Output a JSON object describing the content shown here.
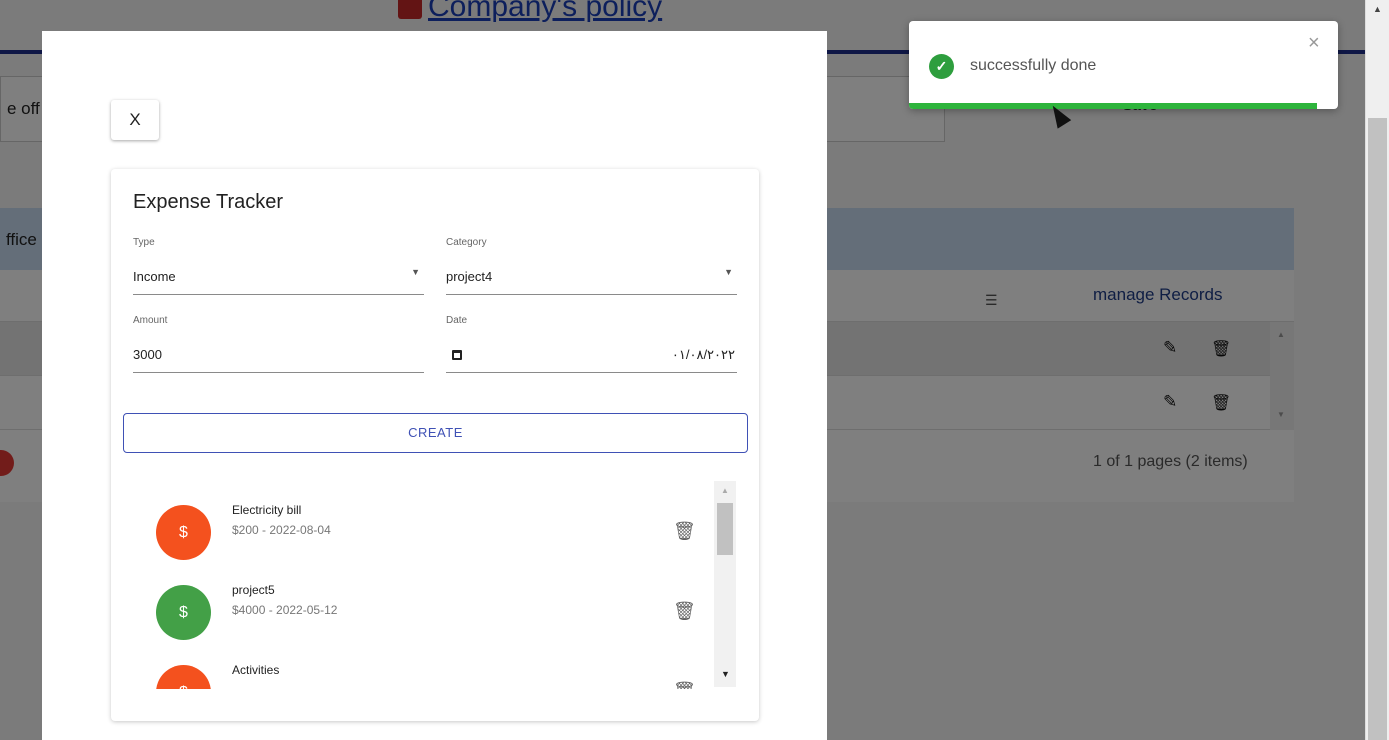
{
  "background": {
    "page_title": "Company's policy",
    "field_text": "e off",
    "button_text": "Save",
    "header_text": "ffice",
    "manage_records": "manage Records",
    "filter_icon": "filter-icon",
    "pagination": "1 of 1 pages (2 items)"
  },
  "modal": {
    "close_label": "X",
    "card_title": "Expense Tracker",
    "type": {
      "label": "Type",
      "value": "Income"
    },
    "category": {
      "label": "Category",
      "value": "project4"
    },
    "amount": {
      "label": "Amount",
      "value": "3000"
    },
    "date": {
      "label": "Date",
      "value": "٠١/٠٨/٢٠٢٢"
    },
    "create_label": "CREATE",
    "items": [
      {
        "title": "Electricity bill",
        "subtitle": "$200 - 2022-08-04",
        "kind": "expense",
        "color": "#f4511e",
        "icon": "dollar-icon"
      },
      {
        "title": "project5",
        "subtitle": "$4000 - 2022-05-12",
        "kind": "income",
        "color": "#43a047",
        "icon": "dollar-icon"
      },
      {
        "title": "Activities",
        "subtitle": "",
        "kind": "expense",
        "color": "#f4511e",
        "icon": "dollar-icon"
      }
    ]
  },
  "toast": {
    "message": "successfully done",
    "status": "success",
    "progress": 0.95,
    "color": "#2eb43c"
  }
}
